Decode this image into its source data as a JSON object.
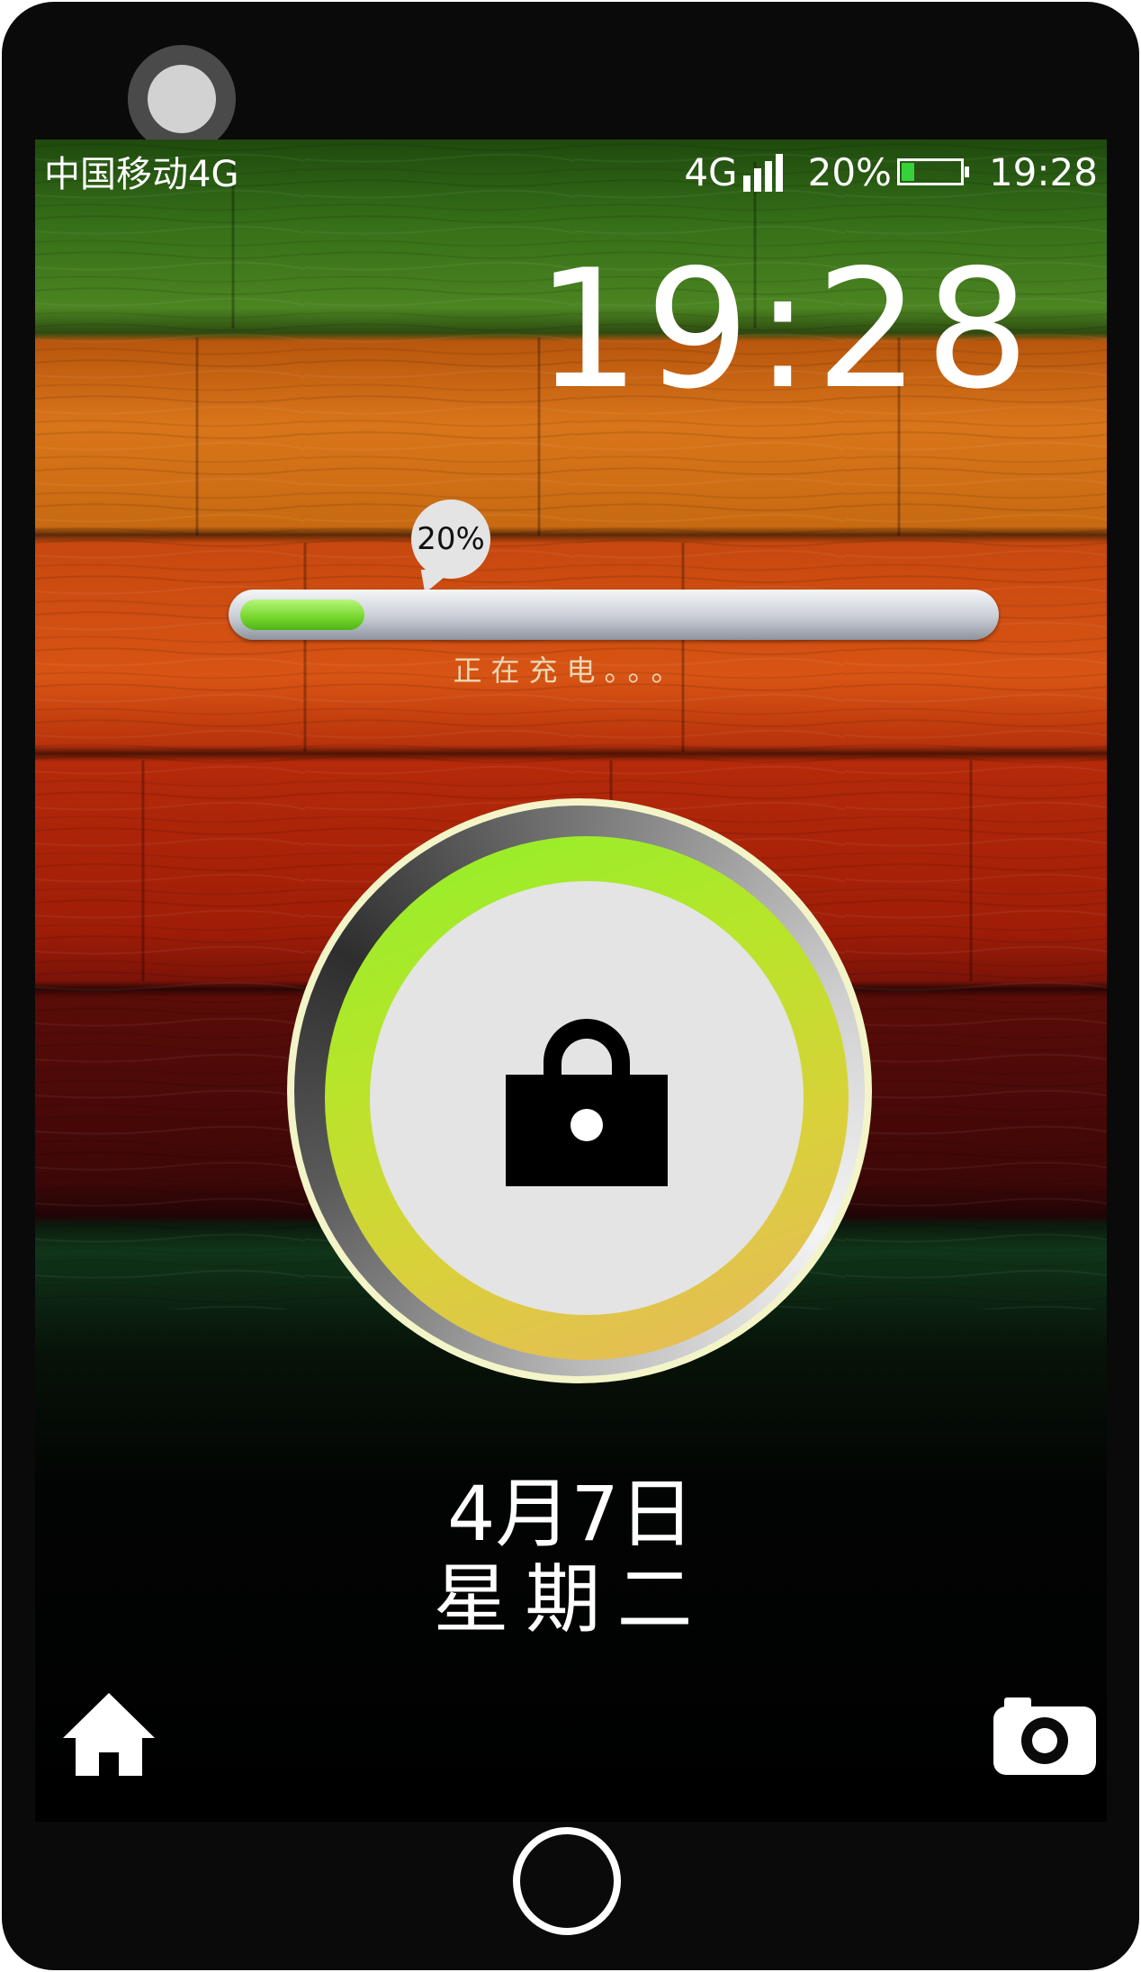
{
  "statusbar": {
    "carrier": "中国移动4G",
    "network": "4G",
    "signal_bars": 4,
    "battery_percent": "20%",
    "battery_level": 0.2,
    "battery_color": "#37d23b",
    "time": "19:28"
  },
  "lockscreen": {
    "clock": "19:28",
    "charge_bubble": "20%",
    "charge_progress": 0.2,
    "charging_text": "正在充电。。。",
    "date": "4月7日",
    "weekday": "星期二",
    "lock_icon": "padlock-icon"
  },
  "dock": {
    "left_icon": "home-icon",
    "right_icon": "camera-icon"
  },
  "device": {
    "home_button_icon": "circle-home-button",
    "front_camera_icon": "front-camera-lens"
  },
  "colors": {
    "wallpaper_bands": [
      "#3c7419",
      "#c7660d",
      "#c73a0f",
      "#a51a08",
      "#4a0a0a",
      "#0c2410"
    ],
    "progress_fill": "#74d62b",
    "ring_green": "#8ef02a",
    "ring_orange": "#e9b65e"
  }
}
